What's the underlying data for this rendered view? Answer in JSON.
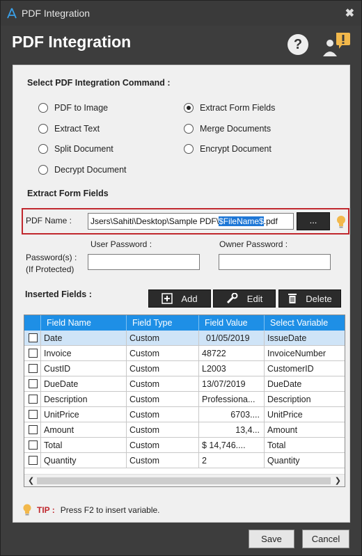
{
  "window": {
    "title": "PDF Integration",
    "close_glyph": "✖"
  },
  "header": {
    "title": "PDF Integration",
    "help_glyph": "?"
  },
  "command": {
    "section_title": "Select PDF Integration Command :",
    "options": [
      {
        "label": "PDF to Image",
        "selected": false
      },
      {
        "label": "Extract Form Fields",
        "selected": true
      },
      {
        "label": "Extract Text",
        "selected": false
      },
      {
        "label": "Merge Documents",
        "selected": false
      },
      {
        "label": "Split Document",
        "selected": false
      },
      {
        "label": "Encrypt Document",
        "selected": false
      },
      {
        "label": "Decrypt Document",
        "selected": false
      }
    ]
  },
  "extract": {
    "section_title": "Extract Form Fields",
    "pdf_name_label": "PDF Name :",
    "pdf_path_prefix": "Jsers\\Sahiti\\Desktop\\Sample PDF\\",
    "pdf_path_variable": "$FileName$",
    "pdf_path_suffix": ".pdf",
    "browse_label": "...",
    "user_password_label": "User Password :",
    "owner_password_label": "Owner Password :",
    "passwords_label_line1": "Password(s) :",
    "passwords_label_line2": "(If Protected)",
    "user_password_value": "",
    "owner_password_value": ""
  },
  "fields": {
    "section_title": "Inserted Fields :",
    "add_label": "Add",
    "edit_label": "Edit",
    "delete_label": "Delete",
    "columns": [
      "Field Name",
      "Field Type",
      "Field Value",
      "Select Variable"
    ],
    "rows": [
      {
        "name": "Date",
        "type": "Custom",
        "value": "01/05/2019",
        "variable": "IssueDate"
      },
      {
        "name": "Invoice",
        "type": "Custom",
        "value": "48722",
        "variable": "InvoiceNumber"
      },
      {
        "name": "CustID",
        "type": "Custom",
        "value": "L2003",
        "variable": "CustomerID"
      },
      {
        "name": "DueDate",
        "type": "Custom",
        "value": "13/07/2019",
        "variable": "DueDate"
      },
      {
        "name": "Description",
        "type": "Custom",
        "value": "Professiona...",
        "variable": "Description"
      },
      {
        "name": "UnitPrice",
        "type": "Custom",
        "value": "6703....",
        "variable": "UnitPrice"
      },
      {
        "name": "Amount",
        "type": "Custom",
        "value": "13,4...",
        "variable": "Amount"
      },
      {
        "name": "Total",
        "type": "Custom",
        "value": "$      14,746....",
        "variable": "Total"
      },
      {
        "name": "Quantity",
        "type": "Custom",
        "value": "2",
        "variable": "Quantity"
      }
    ]
  },
  "tip": {
    "label": "TIP :",
    "text": "Press F2 to insert variable."
  },
  "footer": {
    "save_label": "Save",
    "cancel_label": "Cancel"
  },
  "colors": {
    "accent": "#1e8fe6",
    "highlight_border": "#c0272d",
    "tip_bulb": "#f2b84b"
  }
}
